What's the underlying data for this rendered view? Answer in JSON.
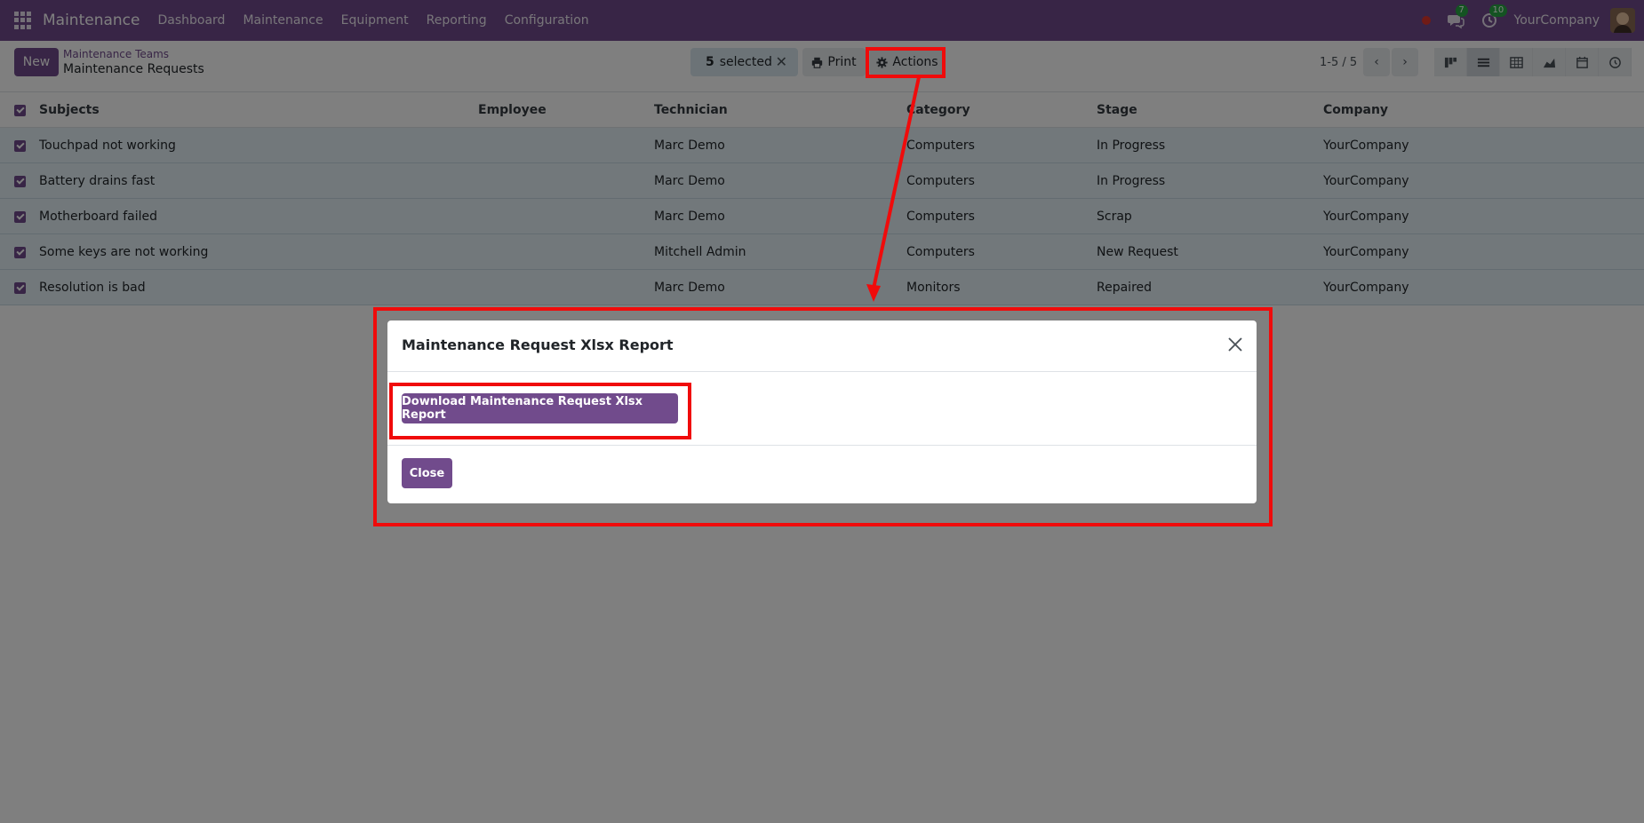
{
  "navbar": {
    "brand": "Maintenance",
    "menu": [
      "Dashboard",
      "Maintenance",
      "Equipment",
      "Reporting",
      "Configuration"
    ],
    "messages_count": "7",
    "activities_count": "10",
    "company": "YourCompany"
  },
  "control": {
    "new_label": "New",
    "breadcrumb_parent": "Maintenance Teams",
    "breadcrumb_current": "Maintenance Requests",
    "selected_count": "5",
    "selected_text": "selected",
    "print_label": "Print",
    "actions_label": "Actions",
    "pager": "1-5 / 5"
  },
  "table": {
    "headers": [
      "Subjects",
      "Employee",
      "Technician",
      "Category",
      "Stage",
      "Company"
    ],
    "rows": [
      {
        "subject": "Touchpad not working",
        "employee": "",
        "technician": "Marc Demo",
        "category": "Computers",
        "stage": "In Progress",
        "company": "YourCompany"
      },
      {
        "subject": "Battery drains fast",
        "employee": "",
        "technician": "Marc Demo",
        "category": "Computers",
        "stage": "In Progress",
        "company": "YourCompany"
      },
      {
        "subject": "Motherboard failed",
        "employee": "",
        "technician": "Marc Demo",
        "category": "Computers",
        "stage": "Scrap",
        "company": "YourCompany"
      },
      {
        "subject": "Some keys are not working",
        "employee": "",
        "technician": "Mitchell Admin",
        "category": "Computers",
        "stage": "New Request",
        "company": "YourCompany"
      },
      {
        "subject": "Resolution is bad",
        "employee": "",
        "technician": "Marc Demo",
        "category": "Monitors",
        "stage": "Repaired",
        "company": "YourCompany"
      }
    ]
  },
  "modal": {
    "title": "Maintenance Request Xlsx Report",
    "download_label": "Download Maintenance Request Xlsx Report",
    "close_label": "Close"
  },
  "colors": {
    "brand": "#714b8c",
    "annotation": "#f00b0b"
  }
}
